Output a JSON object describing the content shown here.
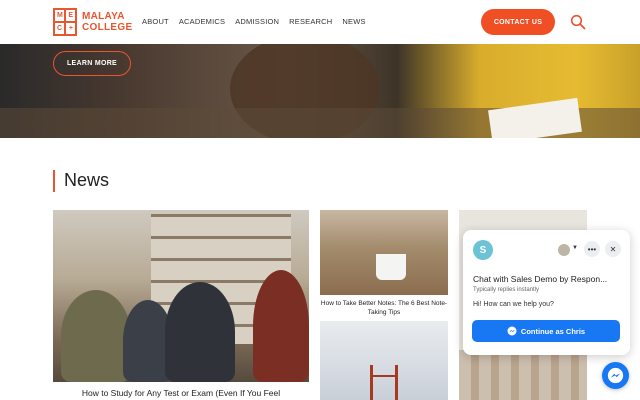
{
  "brand": {
    "line1": "MALAYA",
    "line2": "COLLEGE",
    "accent": "#e8552f"
  },
  "nav": {
    "items": [
      {
        "label": "ABOUT"
      },
      {
        "label": "ACADEMICS"
      },
      {
        "label": "ADMISSION"
      },
      {
        "label": "RESEARCH"
      },
      {
        "label": "NEWS"
      }
    ],
    "contact_label": "CONTACT US",
    "search_icon": "search-icon"
  },
  "hero": {
    "cta_label": "LEARN MORE"
  },
  "news": {
    "heading": "News",
    "cards": [
      {
        "caption": "How to Study for Any Test or Exam (Even If You Feel"
      },
      {
        "caption": "How to Take Better Notes: The 6 Best Note-Taking Tips"
      },
      {
        "caption": ""
      },
      {
        "caption": ""
      }
    ]
  },
  "chat": {
    "avatar_letter": "S",
    "title": "Chat with Sales Demo by Respon...",
    "subtitle": "Typically replies instantly",
    "greeting": "Hi! How can we help you?",
    "button_label": "Continue as Chris",
    "brand_color": "#1877f2"
  }
}
